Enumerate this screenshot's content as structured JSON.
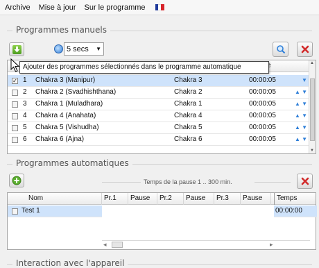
{
  "menu": {
    "items": [
      "Archive",
      "Mise à jour",
      "Sur le programme"
    ],
    "flag_colors": [
      "#1f3a9b",
      "#ffffff",
      "#d7242a"
    ]
  },
  "manual": {
    "section_title": "Programmes manuels",
    "interval_value": "5 secs",
    "tooltip": "Ajouter des programmes sélectionnés dans le programme automatique",
    "header_trailing": "e",
    "rows": [
      {
        "checked": true,
        "num": "1",
        "name": "Chakra 3 (Manipur)",
        "category": "Chakra 3",
        "time": "00:00:05",
        "arrows": "▼",
        "selected": true
      },
      {
        "checked": false,
        "num": "2",
        "name": "Chakra 2 (Svadhishthana)",
        "category": "Chakra 2",
        "time": "00:00:05",
        "arrows": "▲ ▼",
        "selected": false
      },
      {
        "checked": false,
        "num": "3",
        "name": "Chakra 1 (Muladhara)",
        "category": "Chakra 1",
        "time": "00:00:05",
        "arrows": "▲ ▼",
        "selected": false
      },
      {
        "checked": false,
        "num": "4",
        "name": "Chakra 4 (Anahata)",
        "category": "Chakra 4",
        "time": "00:00:05",
        "arrows": "▲ ▼",
        "selected": false
      },
      {
        "checked": false,
        "num": "5",
        "name": "Chakra 5 (Vishudha)",
        "category": "Chakra 5",
        "time": "00:00:05",
        "arrows": "▲ ▼",
        "selected": false
      },
      {
        "checked": false,
        "num": "6",
        "name": "Chakra 6 (Ajna)",
        "category": "Chakra 6",
        "time": "00:00:05",
        "arrows": "▲ ▼",
        "selected": false
      }
    ]
  },
  "automatic": {
    "section_title": "Programmes automatiques",
    "pause_hint": "Temps de la pause 1 .. 300 min.",
    "columns": [
      "Nom",
      "Pr.1",
      "Pause",
      "Pr.2",
      "Pause",
      "Pr.3",
      "Pause",
      "Temps"
    ],
    "rows": [
      {
        "name": "Test 1",
        "time": "00:00:00"
      }
    ]
  },
  "device": {
    "section_title": "Interaction avec l'appareil"
  },
  "colors": {
    "selected_row": "#cfe3fb",
    "delete_red": "#d22b2b",
    "arrow_blue": "#2f7fd8"
  }
}
